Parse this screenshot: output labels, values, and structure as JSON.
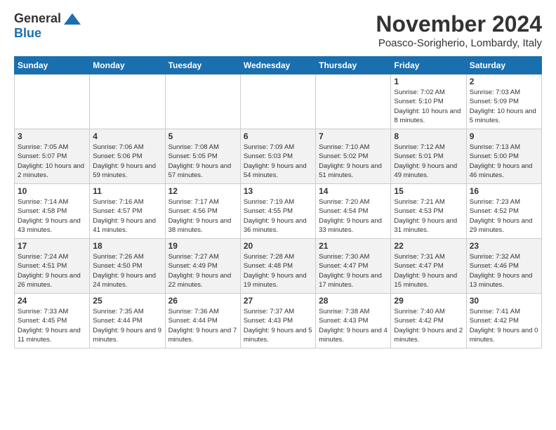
{
  "logo": {
    "general": "General",
    "blue": "Blue"
  },
  "title": "November 2024",
  "subtitle": "Poasco-Sorigherio, Lombardy, Italy",
  "days_of_week": [
    "Sunday",
    "Monday",
    "Tuesday",
    "Wednesday",
    "Thursday",
    "Friday",
    "Saturday"
  ],
  "weeks": [
    [
      {
        "day": "",
        "info": ""
      },
      {
        "day": "",
        "info": ""
      },
      {
        "day": "",
        "info": ""
      },
      {
        "day": "",
        "info": ""
      },
      {
        "day": "",
        "info": ""
      },
      {
        "day": "1",
        "info": "Sunrise: 7:02 AM\nSunset: 5:10 PM\nDaylight: 10 hours and 8 minutes."
      },
      {
        "day": "2",
        "info": "Sunrise: 7:03 AM\nSunset: 5:09 PM\nDaylight: 10 hours and 5 minutes."
      }
    ],
    [
      {
        "day": "3",
        "info": "Sunrise: 7:05 AM\nSunset: 5:07 PM\nDaylight: 10 hours and 2 minutes."
      },
      {
        "day": "4",
        "info": "Sunrise: 7:06 AM\nSunset: 5:06 PM\nDaylight: 9 hours and 59 minutes."
      },
      {
        "day": "5",
        "info": "Sunrise: 7:08 AM\nSunset: 5:05 PM\nDaylight: 9 hours and 57 minutes."
      },
      {
        "day": "6",
        "info": "Sunrise: 7:09 AM\nSunset: 5:03 PM\nDaylight: 9 hours and 54 minutes."
      },
      {
        "day": "7",
        "info": "Sunrise: 7:10 AM\nSunset: 5:02 PM\nDaylight: 9 hours and 51 minutes."
      },
      {
        "day": "8",
        "info": "Sunrise: 7:12 AM\nSunset: 5:01 PM\nDaylight: 9 hours and 49 minutes."
      },
      {
        "day": "9",
        "info": "Sunrise: 7:13 AM\nSunset: 5:00 PM\nDaylight: 9 hours and 46 minutes."
      }
    ],
    [
      {
        "day": "10",
        "info": "Sunrise: 7:14 AM\nSunset: 4:58 PM\nDaylight: 9 hours and 43 minutes."
      },
      {
        "day": "11",
        "info": "Sunrise: 7:16 AM\nSunset: 4:57 PM\nDaylight: 9 hours and 41 minutes."
      },
      {
        "day": "12",
        "info": "Sunrise: 7:17 AM\nSunset: 4:56 PM\nDaylight: 9 hours and 38 minutes."
      },
      {
        "day": "13",
        "info": "Sunrise: 7:19 AM\nSunset: 4:55 PM\nDaylight: 9 hours and 36 minutes."
      },
      {
        "day": "14",
        "info": "Sunrise: 7:20 AM\nSunset: 4:54 PM\nDaylight: 9 hours and 33 minutes."
      },
      {
        "day": "15",
        "info": "Sunrise: 7:21 AM\nSunset: 4:53 PM\nDaylight: 9 hours and 31 minutes."
      },
      {
        "day": "16",
        "info": "Sunrise: 7:23 AM\nSunset: 4:52 PM\nDaylight: 9 hours and 29 minutes."
      }
    ],
    [
      {
        "day": "17",
        "info": "Sunrise: 7:24 AM\nSunset: 4:51 PM\nDaylight: 9 hours and 26 minutes."
      },
      {
        "day": "18",
        "info": "Sunrise: 7:26 AM\nSunset: 4:50 PM\nDaylight: 9 hours and 24 minutes."
      },
      {
        "day": "19",
        "info": "Sunrise: 7:27 AM\nSunset: 4:49 PM\nDaylight: 9 hours and 22 minutes."
      },
      {
        "day": "20",
        "info": "Sunrise: 7:28 AM\nSunset: 4:48 PM\nDaylight: 9 hours and 19 minutes."
      },
      {
        "day": "21",
        "info": "Sunrise: 7:30 AM\nSunset: 4:47 PM\nDaylight: 9 hours and 17 minutes."
      },
      {
        "day": "22",
        "info": "Sunrise: 7:31 AM\nSunset: 4:47 PM\nDaylight: 9 hours and 15 minutes."
      },
      {
        "day": "23",
        "info": "Sunrise: 7:32 AM\nSunset: 4:46 PM\nDaylight: 9 hours and 13 minutes."
      }
    ],
    [
      {
        "day": "24",
        "info": "Sunrise: 7:33 AM\nSunset: 4:45 PM\nDaylight: 9 hours and 11 minutes."
      },
      {
        "day": "25",
        "info": "Sunrise: 7:35 AM\nSunset: 4:44 PM\nDaylight: 9 hours and 9 minutes."
      },
      {
        "day": "26",
        "info": "Sunrise: 7:36 AM\nSunset: 4:44 PM\nDaylight: 9 hours and 7 minutes."
      },
      {
        "day": "27",
        "info": "Sunrise: 7:37 AM\nSunset: 4:43 PM\nDaylight: 9 hours and 5 minutes."
      },
      {
        "day": "28",
        "info": "Sunrise: 7:38 AM\nSunset: 4:43 PM\nDaylight: 9 hours and 4 minutes."
      },
      {
        "day": "29",
        "info": "Sunrise: 7:40 AM\nSunset: 4:42 PM\nDaylight: 9 hours and 2 minutes."
      },
      {
        "day": "30",
        "info": "Sunrise: 7:41 AM\nSunset: 4:42 PM\nDaylight: 9 hours and 0 minutes."
      }
    ]
  ]
}
